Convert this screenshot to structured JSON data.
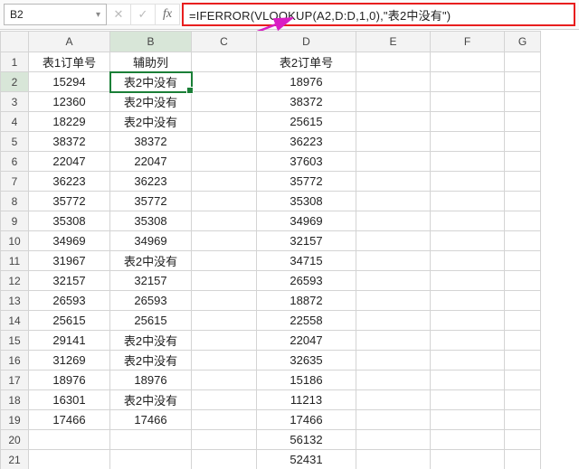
{
  "namebox": {
    "value": "B2"
  },
  "formula_bar": {
    "formula": "=IFERROR(VLOOKUP(A2,D:D,1,0),\"表2中没有\")"
  },
  "icons": {
    "cancel": "✕",
    "confirm": "✓",
    "fx": "fx",
    "caret": "▾"
  },
  "columns": [
    "A",
    "B",
    "C",
    "D",
    "E",
    "F",
    "G"
  ],
  "headers": {
    "A": "表1订单号",
    "B": "辅助列",
    "C": "",
    "D": "表2订单号",
    "E": "",
    "F": "",
    "G": ""
  },
  "rows": [
    {
      "n": 1,
      "A": "表1订单号",
      "B": "辅助列",
      "C": "",
      "D": "表2订单号"
    },
    {
      "n": 2,
      "A": "15294",
      "B": "表2中没有",
      "C": "",
      "D": "18976"
    },
    {
      "n": 3,
      "A": "12360",
      "B": "表2中没有",
      "C": "",
      "D": "38372"
    },
    {
      "n": 4,
      "A": "18229",
      "B": "表2中没有",
      "C": "",
      "D": "25615"
    },
    {
      "n": 5,
      "A": "38372",
      "B": "38372",
      "C": "",
      "D": "36223"
    },
    {
      "n": 6,
      "A": "22047",
      "B": "22047",
      "C": "",
      "D": "37603"
    },
    {
      "n": 7,
      "A": "36223",
      "B": "36223",
      "C": "",
      "D": "35772"
    },
    {
      "n": 8,
      "A": "35772",
      "B": "35772",
      "C": "",
      "D": "35308"
    },
    {
      "n": 9,
      "A": "35308",
      "B": "35308",
      "C": "",
      "D": "34969"
    },
    {
      "n": 10,
      "A": "34969",
      "B": "34969",
      "C": "",
      "D": "32157"
    },
    {
      "n": 11,
      "A": "31967",
      "B": "表2中没有",
      "C": "",
      "D": "34715"
    },
    {
      "n": 12,
      "A": "32157",
      "B": "32157",
      "C": "",
      "D": "26593"
    },
    {
      "n": 13,
      "A": "26593",
      "B": "26593",
      "C": "",
      "D": "18872"
    },
    {
      "n": 14,
      "A": "25615",
      "B": "25615",
      "C": "",
      "D": "22558"
    },
    {
      "n": 15,
      "A": "29141",
      "B": "表2中没有",
      "C": "",
      "D": "22047"
    },
    {
      "n": 16,
      "A": "31269",
      "B": "表2中没有",
      "C": "",
      "D": "32635"
    },
    {
      "n": 17,
      "A": "18976",
      "B": "18976",
      "C": "",
      "D": "15186"
    },
    {
      "n": 18,
      "A": "16301",
      "B": "表2中没有",
      "C": "",
      "D": "11213"
    },
    {
      "n": 19,
      "A": "17466",
      "B": "17466",
      "C": "",
      "D": "17466"
    },
    {
      "n": 20,
      "A": "",
      "B": "",
      "C": "",
      "D": "56132"
    },
    {
      "n": 21,
      "A": "",
      "B": "",
      "C": "",
      "D": "52431"
    }
  ],
  "active_cell": "B2"
}
